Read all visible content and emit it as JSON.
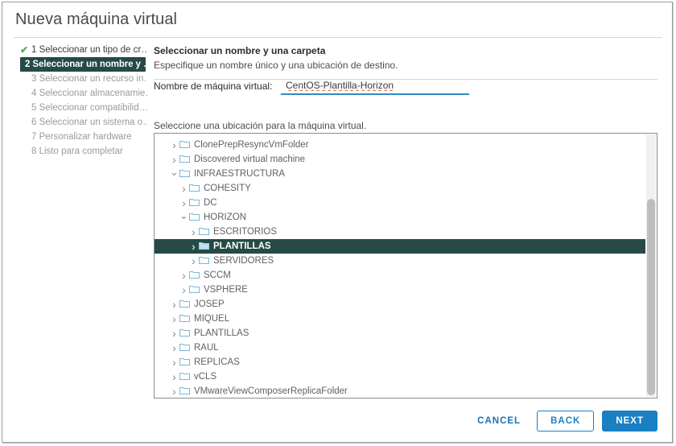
{
  "window": {
    "title": "Nueva máquina virtual"
  },
  "steps": [
    {
      "label": "1 Seleccionar un tipo de cr…",
      "state": "done",
      "check": "✔"
    },
    {
      "label": "2 Seleccionar un nombre y …",
      "state": "active",
      "check": ""
    },
    {
      "label": "3 Seleccionar un recurso in…",
      "state": "pending",
      "check": ""
    },
    {
      "label": "4 Seleccionar almacenamie…",
      "state": "pending",
      "check": ""
    },
    {
      "label": "5 Seleccionar compatibilid…",
      "state": "pending",
      "check": ""
    },
    {
      "label": "6 Seleccionar un sistema o…",
      "state": "pending",
      "check": ""
    },
    {
      "label": "7 Personalizar hardware",
      "state": "pending",
      "check": ""
    },
    {
      "label": "8 Listo para completar",
      "state": "pending",
      "check": ""
    }
  ],
  "pane": {
    "title": "Seleccionar un nombre y una carpeta",
    "subtitle": "Especifique un nombre único y una ubicación de destino."
  },
  "name_field": {
    "label": "Nombre de máquina virtual:",
    "value": "CentOS-Plantilla-Horizon",
    "placeholder": "Nombre de máquina virtual"
  },
  "location": {
    "caption": "Seleccione una ubicación para la máquina virtual.",
    "tree": [
      {
        "label": "ClonePrepResyncVmFolder",
        "depth": 0,
        "caret": "collapsed",
        "selected": false
      },
      {
        "label": "Discovered virtual machine",
        "depth": 0,
        "caret": "collapsed",
        "selected": false
      },
      {
        "label": "INFRAESTRUCTURA",
        "depth": 0,
        "caret": "expanded",
        "selected": false
      },
      {
        "label": "COHESITY",
        "depth": 1,
        "caret": "collapsed",
        "selected": false
      },
      {
        "label": "DC",
        "depth": 1,
        "caret": "collapsed",
        "selected": false
      },
      {
        "label": "HORIZON",
        "depth": 1,
        "caret": "expanded",
        "selected": false
      },
      {
        "label": "ESCRITORIOS",
        "depth": 2,
        "caret": "collapsed",
        "selected": false
      },
      {
        "label": "PLANTILLAS",
        "depth": 2,
        "caret": "collapsed",
        "selected": true
      },
      {
        "label": "SERVIDORES",
        "depth": 2,
        "caret": "collapsed",
        "selected": false
      },
      {
        "label": "SCCM",
        "depth": 1,
        "caret": "collapsed",
        "selected": false
      },
      {
        "label": "VSPHERE",
        "depth": 1,
        "caret": "collapsed",
        "selected": false
      },
      {
        "label": "JOSEP",
        "depth": 0,
        "caret": "collapsed",
        "selected": false
      },
      {
        "label": "MIQUEL",
        "depth": 0,
        "caret": "collapsed",
        "selected": false
      },
      {
        "label": "PLANTILLAS",
        "depth": 0,
        "caret": "collapsed",
        "selected": false
      },
      {
        "label": "RAUL",
        "depth": 0,
        "caret": "collapsed",
        "selected": false
      },
      {
        "label": "REPLICAS",
        "depth": 0,
        "caret": "collapsed",
        "selected": false
      },
      {
        "label": "vCLS",
        "depth": 0,
        "caret": "collapsed",
        "selected": false
      },
      {
        "label": "VMwareViewComposerReplicaFolder",
        "depth": 0,
        "caret": "collapsed",
        "selected": false
      }
    ]
  },
  "footer": {
    "cancel": "CANCEL",
    "back": "BACK",
    "next": "NEXT"
  },
  "colors": {
    "accent_blue": "#1b7fc4",
    "selection_teal": "#264a45",
    "check_green": "#4caf50",
    "spellcheck_red": "#e05a52",
    "folder_blue": "#7ab6d9"
  }
}
